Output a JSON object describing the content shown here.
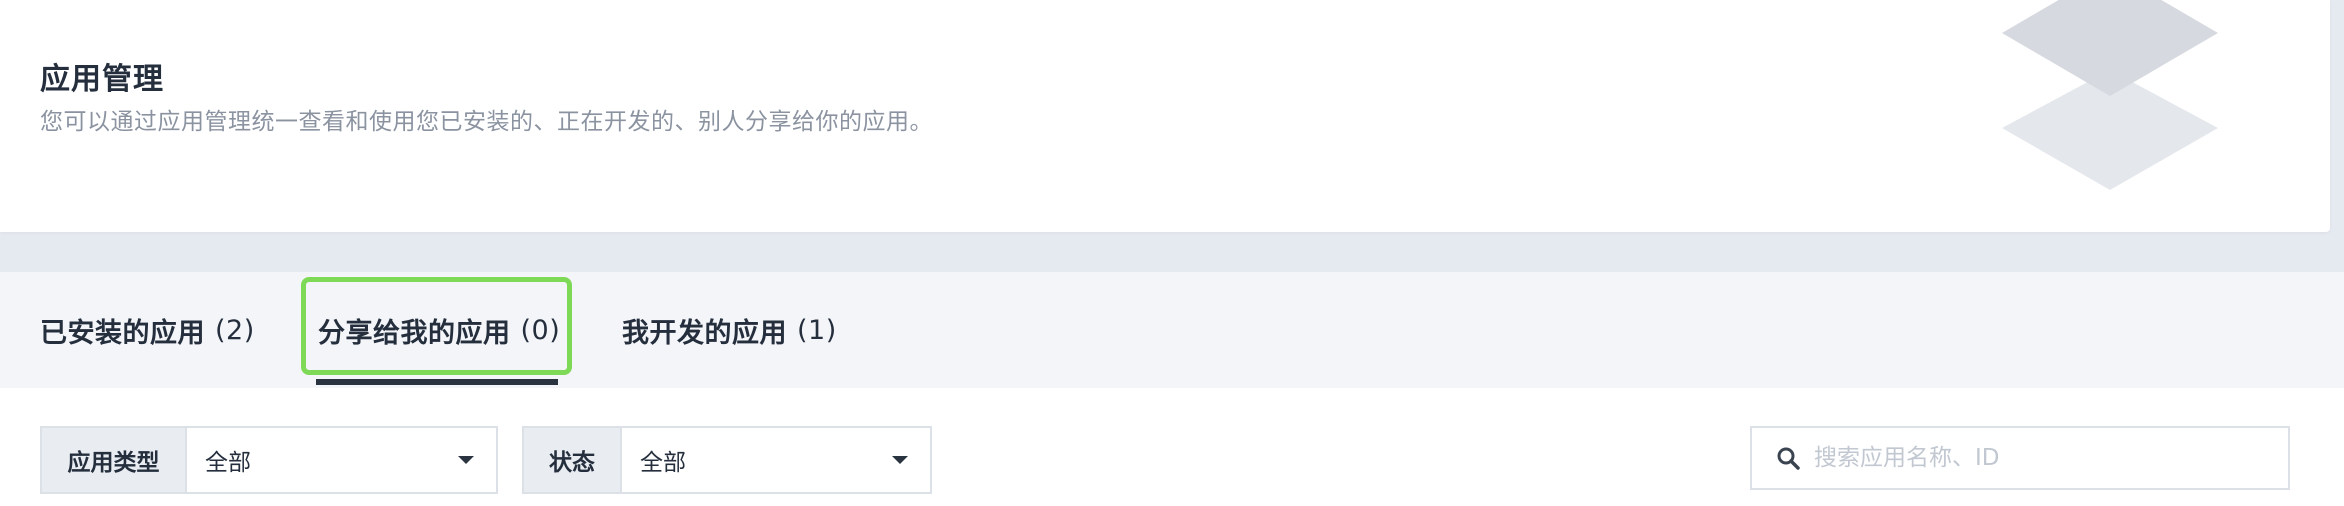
{
  "header": {
    "title": "应用管理",
    "description": "您可以通过应用管理统一查看和使用您已安装的、正在开发的、别人分享给你的应用。",
    "illustration_icon": "layers-icon"
  },
  "tabs": [
    {
      "label": "已安装的应用",
      "count": "(2)",
      "active": false
    },
    {
      "label": "分享给我的应用",
      "count": "(0)",
      "active": true
    },
    {
      "label": "我开发的应用",
      "count": "(1)",
      "active": false
    }
  ],
  "filters": {
    "app_type": {
      "label": "应用类型",
      "value": "全部"
    },
    "status": {
      "label": "状态",
      "value": "全部"
    }
  },
  "search": {
    "placeholder": "搜索应用名称、ID",
    "value": "",
    "icon": "search-icon"
  },
  "colors": {
    "highlight": "#7ed957",
    "text_primary": "#242e3d",
    "text_secondary": "#8b93a1",
    "tab_underline": "#2a3340"
  }
}
